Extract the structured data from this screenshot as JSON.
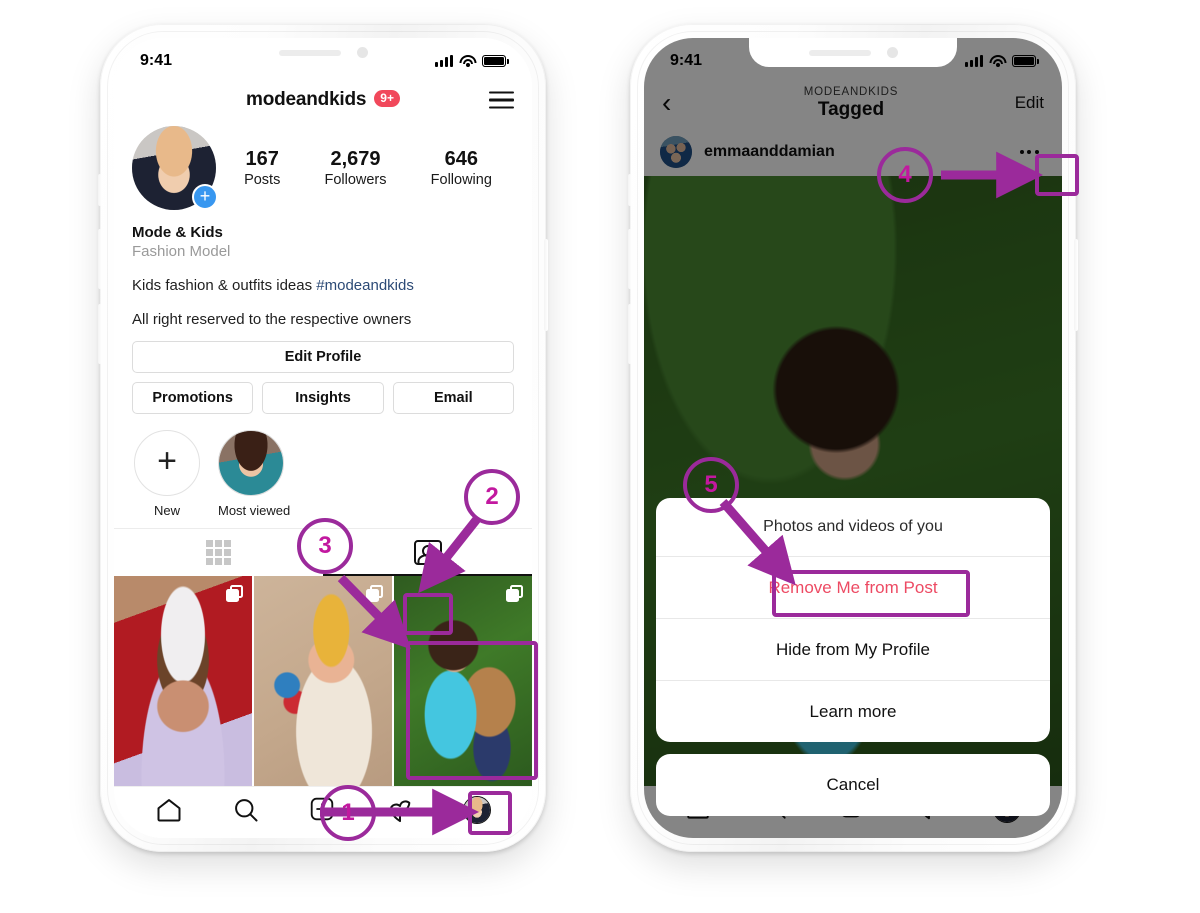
{
  "left_phone": {
    "status_bar": {
      "time": "9:41",
      "signal": "signal-icon",
      "wifi": "wifi-icon",
      "battery": "battery-icon"
    },
    "header": {
      "username": "modeandkids",
      "badge": "9+",
      "menu_icon": "hamburger-menu-icon"
    },
    "profile": {
      "avatar": "profile-avatar",
      "add_story_icon": "plus-badge-icon",
      "stats": [
        {
          "value": "167",
          "label": "Posts"
        },
        {
          "value": "2,679",
          "label": "Followers"
        },
        {
          "value": "646",
          "label": "Following"
        }
      ],
      "name": "Mode & Kids",
      "category": "Fashion Model",
      "bio_line_1": "Kids fashion & outfits ideas ",
      "bio_hashtag": "#modeandkids",
      "bio_line_2": "All right reserved to the respective owners"
    },
    "buttons": {
      "edit_profile": "Edit Profile",
      "promotions": "Promotions",
      "insights": "Insights",
      "email": "Email"
    },
    "highlights": [
      {
        "label": "New",
        "icon": "plus-icon"
      },
      {
        "label": "Most viewed",
        "icon": "highlight-cover"
      }
    ],
    "tabs": [
      {
        "name": "grid-tab",
        "icon": "grid-icon",
        "active": false
      },
      {
        "name": "tagged-tab",
        "icon": "tagged-person-icon",
        "active": true
      }
    ],
    "grid_posts": [
      {
        "alt": "baby-with-white-bow-photo",
        "multi_icon": "multi-photo-icon"
      },
      {
        "alt": "baby-in-striped-onesie-photo",
        "multi_icon": "multi-photo-icon"
      },
      {
        "alt": "girl-with-teddy-bear-on-grass-photo",
        "multi_icon": "multi-photo-icon"
      }
    ],
    "nav_bar": [
      {
        "name": "nav-home",
        "icon": "home-icon"
      },
      {
        "name": "nav-search",
        "icon": "search-icon"
      },
      {
        "name": "nav-add",
        "icon": "plus-square-icon"
      },
      {
        "name": "nav-activity",
        "icon": "heart-icon"
      },
      {
        "name": "nav-profile",
        "icon": "profile-avatar-icon"
      }
    ]
  },
  "right_phone": {
    "status_bar": {
      "time": "9:41",
      "signal": "signal-icon",
      "wifi": "wifi-icon",
      "battery": "battery-icon"
    },
    "header": {
      "back_icon": "chevron-left-icon",
      "subtitle": "MODEANDKIDS",
      "title": "Tagged",
      "edit": "Edit"
    },
    "post": {
      "avatar": "emmaanddamian-avatar",
      "username": "emmaanddamian",
      "more_icon": "more-options-icon",
      "photo_alt": "girl-with-teddy-bear-on-grass-photo"
    },
    "action_sheet": {
      "title": "Photos and videos of you",
      "options": [
        {
          "label": "Remove Me from Post",
          "danger": true
        },
        {
          "label": "Hide from My Profile",
          "danger": false
        },
        {
          "label": "Learn more",
          "danger": false
        }
      ],
      "cancel": "Cancel"
    }
  },
  "annotations": [
    {
      "number": "1",
      "target": "nav-profile"
    },
    {
      "number": "2",
      "target": "tagged-tab"
    },
    {
      "number": "3",
      "target": "tagged-photo-thumbnail"
    },
    {
      "number": "4",
      "target": "more-options-button"
    },
    {
      "number": "5",
      "target": "remove-me-from-post-option"
    }
  ],
  "colors": {
    "annotation_circle": "#9b2a9b",
    "annotation_number": "#c2189f",
    "danger_text": "#ed4a63",
    "badge_red": "#f1485b",
    "story_plus_blue": "#3897f0",
    "hashtag_blue": "#2c4a76"
  }
}
